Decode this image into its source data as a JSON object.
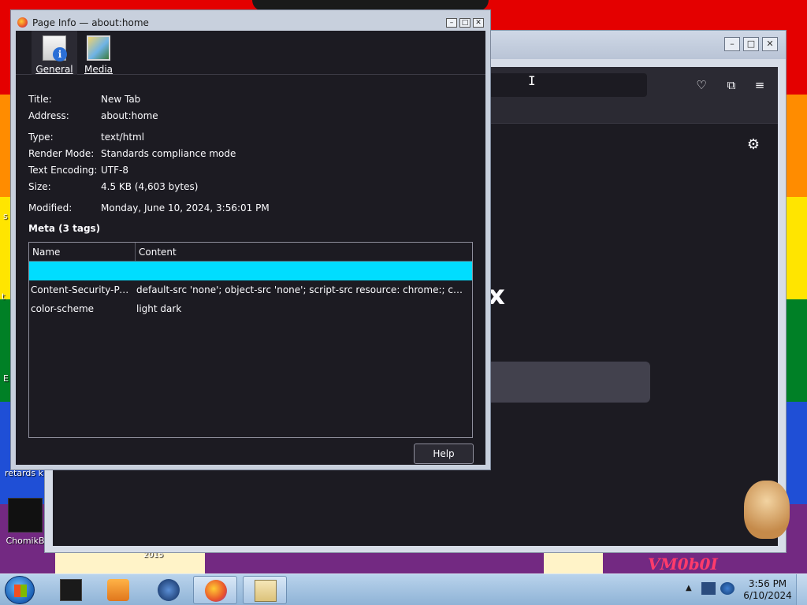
{
  "dialog": {
    "title": "Page Info — about:home",
    "tabs": [
      {
        "label": "General",
        "icon": "info-document-icon",
        "active": true
      },
      {
        "label": "Media",
        "icon": "media-image-icon",
        "active": false
      }
    ],
    "fields": {
      "title_label": "Title:",
      "title_value": "New Tab",
      "address_label": "Address:",
      "address_value": "about:home",
      "type_label": "Type:",
      "type_value": "text/html",
      "render_label": "Render Mode:",
      "render_value": "Standards compliance mode",
      "encoding_label": "Text Encoding:",
      "encoding_value": "UTF-8",
      "size_label": "Size:",
      "size_value": "4.5 KB (4,603 bytes)",
      "modified_label": "Modified:",
      "modified_value": "Monday, June 10, 2024, 3:56:01 PM"
    },
    "meta_heading": "Meta (3 tags)",
    "meta_table": {
      "columns": [
        "Name",
        "Content"
      ],
      "rows": [
        {
          "name": "Content-Security-Polic...",
          "content": "default-src 'none'; object-src 'none'; script-src resource: chrome:; connect-src ..."
        },
        {
          "name": "color-scheme",
          "content": "light dark"
        }
      ],
      "selection_color": "#00ddff"
    },
    "help_label": "Help"
  },
  "firefox": {
    "partial_title": "x"
  },
  "desktop": {
    "icon_label": "ChomikB",
    "text_fragments": [
      "retards kn",
      "2015",
      "E",
      "s",
      "t"
    ],
    "watermark": "VM0b0I"
  },
  "taskbar": {
    "time": "3:56 PM",
    "date": "6/10/2024"
  },
  "colors": {
    "dark_bg": "#1c1b22",
    "toolbar": "#2b2a33",
    "accent": "#00ddff"
  }
}
